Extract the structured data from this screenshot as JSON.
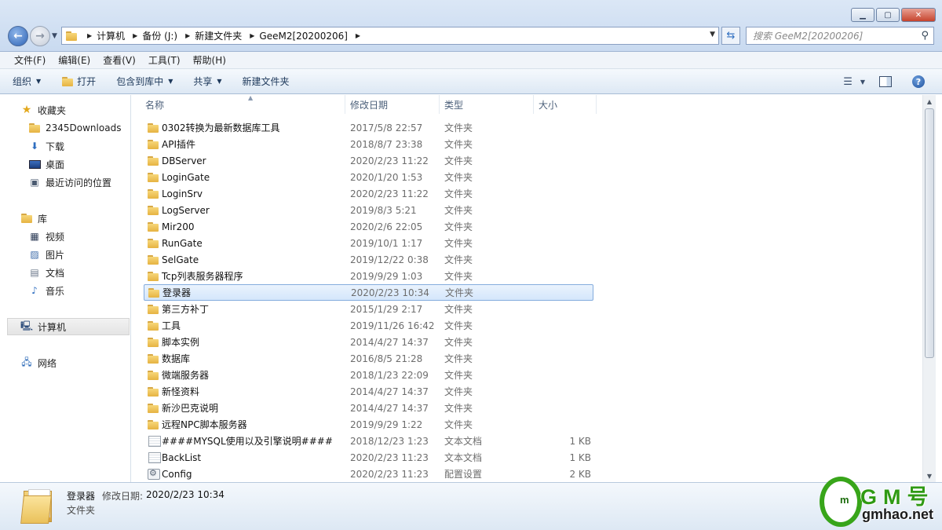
{
  "window": {
    "min_icon": "minimize-icon",
    "max_icon": "maximize-icon",
    "close_icon": "close-icon"
  },
  "address": {
    "crumbs": [
      "计算机",
      "备份 (J:)",
      "新建文件夹",
      "GeeM2[20200206]"
    ]
  },
  "search": {
    "placeholder": "搜索 GeeM2[20200206]"
  },
  "menu": [
    "文件(F)",
    "编辑(E)",
    "查看(V)",
    "工具(T)",
    "帮助(H)"
  ],
  "toolbar": {
    "organize": "组织",
    "open": "打开",
    "include": "包含到库中",
    "share": "共享",
    "new_folder": "新建文件夹"
  },
  "nav": {
    "favorites": "收藏夹",
    "downloads_2345": "2345Downloads",
    "downloads": "下载",
    "desktop": "桌面",
    "recent": "最近访问的位置",
    "libraries": "库",
    "videos": "视频",
    "pictures": "图片",
    "documents": "文档",
    "music": "音乐",
    "computer": "计算机",
    "network": "网络"
  },
  "columns": {
    "name": "名称",
    "date": "修改日期",
    "type": "类型",
    "size": "大小"
  },
  "files": [
    {
      "name": "0302转换为最新数据库工具",
      "date": "2017/5/8 22:57",
      "type": "文件夹",
      "size": "",
      "icon": "folder"
    },
    {
      "name": "API插件",
      "date": "2018/8/7 23:38",
      "type": "文件夹",
      "size": "",
      "icon": "folder"
    },
    {
      "name": "DBServer",
      "date": "2020/2/23 11:22",
      "type": "文件夹",
      "size": "",
      "icon": "folder"
    },
    {
      "name": "LoginGate",
      "date": "2020/1/20 1:53",
      "type": "文件夹",
      "size": "",
      "icon": "folder"
    },
    {
      "name": "LoginSrv",
      "date": "2020/2/23 11:22",
      "type": "文件夹",
      "size": "",
      "icon": "folder"
    },
    {
      "name": "LogServer",
      "date": "2019/8/3 5:21",
      "type": "文件夹",
      "size": "",
      "icon": "folder"
    },
    {
      "name": "Mir200",
      "date": "2020/2/6 22:05",
      "type": "文件夹",
      "size": "",
      "icon": "folder"
    },
    {
      "name": "RunGate",
      "date": "2019/10/1 1:17",
      "type": "文件夹",
      "size": "",
      "icon": "folder"
    },
    {
      "name": "SelGate",
      "date": "2019/12/22 0:38",
      "type": "文件夹",
      "size": "",
      "icon": "folder"
    },
    {
      "name": "Tcp列表服务器程序",
      "date": "2019/9/29 1:03",
      "type": "文件夹",
      "size": "",
      "icon": "folder"
    },
    {
      "name": "登录器",
      "date": "2020/2/23 10:34",
      "type": "文件夹",
      "size": "",
      "icon": "folder",
      "selected": true
    },
    {
      "name": "第三方补丁",
      "date": "2015/1/29 2:17",
      "type": "文件夹",
      "size": "",
      "icon": "folder"
    },
    {
      "name": "工具",
      "date": "2019/11/26 16:42",
      "type": "文件夹",
      "size": "",
      "icon": "folder"
    },
    {
      "name": "脚本实例",
      "date": "2014/4/27 14:37",
      "type": "文件夹",
      "size": "",
      "icon": "folder"
    },
    {
      "name": "数据库",
      "date": "2016/8/5 21:28",
      "type": "文件夹",
      "size": "",
      "icon": "folder"
    },
    {
      "name": "微端服务器",
      "date": "2018/1/23 22:09",
      "type": "文件夹",
      "size": "",
      "icon": "folder"
    },
    {
      "name": "新怪资料",
      "date": "2014/4/27 14:37",
      "type": "文件夹",
      "size": "",
      "icon": "folder"
    },
    {
      "name": "新沙巴克说明",
      "date": "2014/4/27 14:37",
      "type": "文件夹",
      "size": "",
      "icon": "folder"
    },
    {
      "name": "远程NPC脚本服务器",
      "date": "2019/9/29 1:22",
      "type": "文件夹",
      "size": "",
      "icon": "folder"
    },
    {
      "name": "####MYSQL使用以及引擎说明####",
      "date": "2018/12/23 1:23",
      "type": "文本文档",
      "size": "1 KB",
      "icon": "document"
    },
    {
      "name": "BackList",
      "date": "2020/2/23 11:23",
      "type": "文本文档",
      "size": "1 KB",
      "icon": "document"
    },
    {
      "name": "Config",
      "date": "2020/2/23 11:23",
      "type": "配置设置",
      "size": "2 KB",
      "icon": "config"
    }
  ],
  "details": {
    "name": "登录器",
    "date_label": "修改日期:",
    "date": "2020/2/23 10:34",
    "type": "文件夹"
  },
  "watermark": {
    "title": "GM号",
    "letter": "m",
    "url": "gmhao.net"
  }
}
